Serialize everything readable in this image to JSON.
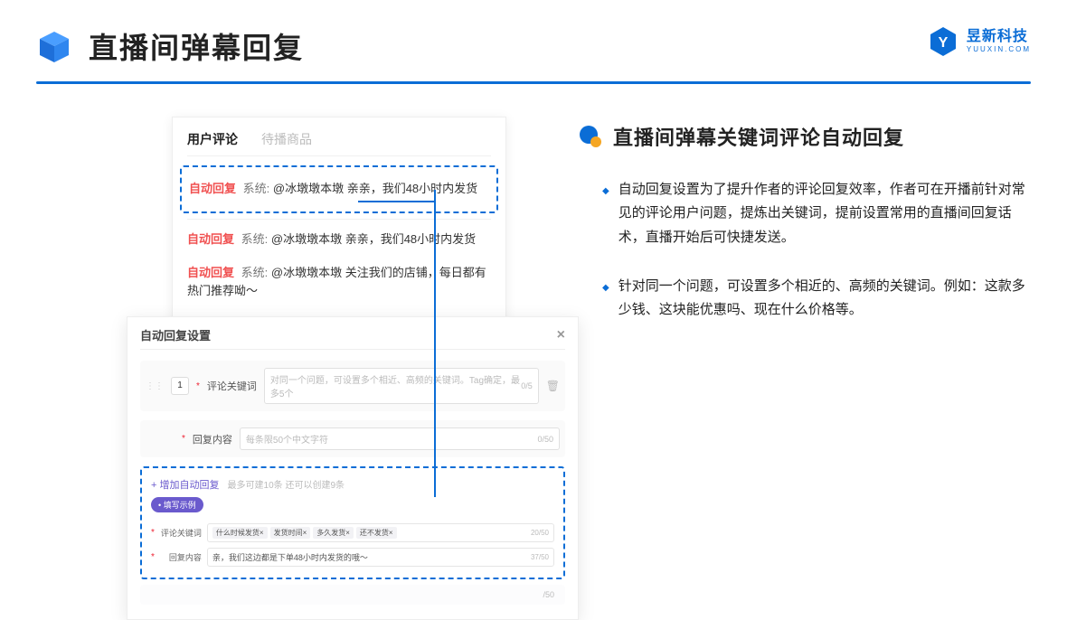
{
  "header": {
    "title": "直播间弹幕回复"
  },
  "brand": {
    "name": "昱新科技",
    "sub": "YUUXIN.COM"
  },
  "left": {
    "tabs": {
      "active": "用户评论",
      "inactive": "待播商品"
    },
    "comments": {
      "c1_tag": "自动回复",
      "c1_sys": "系统:",
      "c1_text": "@冰墩墩本墩 亲亲，我们48小时内发货",
      "c2_tag": "自动回复",
      "c2_sys": "系统:",
      "c2_text": "@冰墩墩本墩 亲亲，我们48小时内发货",
      "c3_tag": "自动回复",
      "c3_sys": "系统:",
      "c3_text": "@冰墩墩本墩 关注我们的店铺，每日都有热门推荐呦～"
    },
    "settings": {
      "title": "自动回复设置",
      "row1_num": "1",
      "row1_label": "评论关键词",
      "row1_placeholder": "对同一个问题，可设置多个相近、高频的关键词。Tag确定，最多5个",
      "row1_counter": "0/5",
      "row2_label": "回复内容",
      "row2_placeholder": "每条限50个中文字符",
      "row2_counter": "0/50",
      "add_link": "+ 增加自动回复",
      "add_note": "最多可建10条 还可以创建9条",
      "example_pill": "• 填写示例",
      "ex_label1": "评论关键词",
      "chip1": "什么时候发货×",
      "chip2": "发货时间×",
      "chip3": "多久发货×",
      "chip4": "还不发货×",
      "ex_counter1": "20/50",
      "ex_label2": "回复内容",
      "ex_value2": "亲，我们这边都是下单48小时内发货的哦～",
      "ex_counter2": "37/50",
      "outer_counter": "/50"
    }
  },
  "right": {
    "section_title": "直播间弹幕关键词评论自动回复",
    "p1": "自动回复设置为了提升作者的评论回复效率，作者可在开播前针对常见的评论用户问题，提炼出关键词，提前设置常用的直播间回复话术，直播开始后可快捷发送。",
    "p2": "针对同一个问题，可设置多个相近的、高频的关键词。例如：这款多少钱、这块能优惠吗、现在什么价格等。"
  }
}
